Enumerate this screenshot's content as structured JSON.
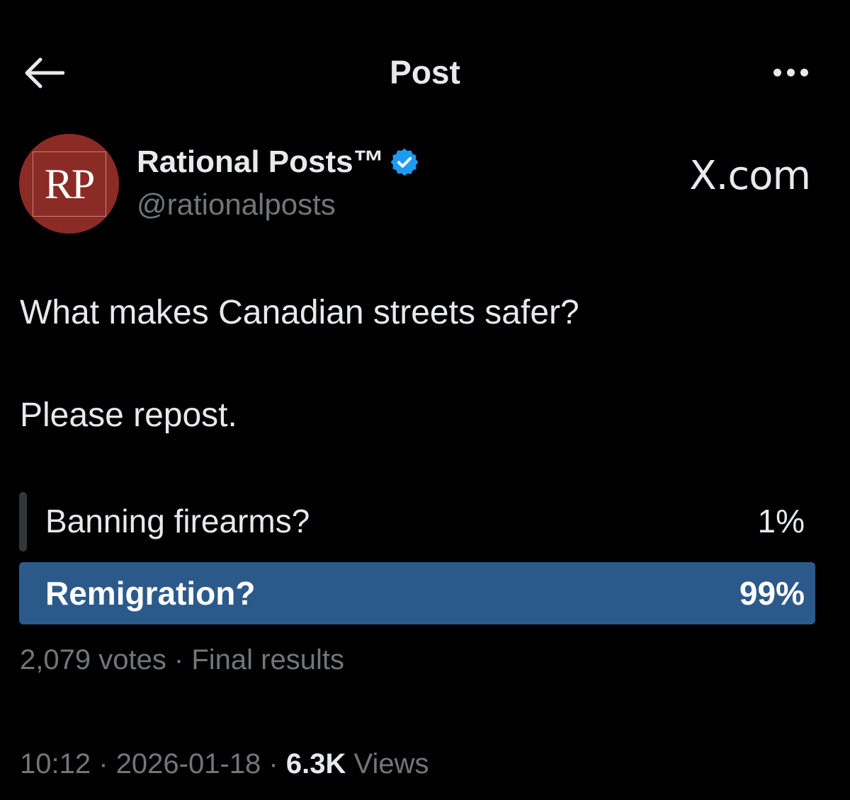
{
  "header": {
    "title": "Post",
    "back_icon": "arrow-left-icon",
    "more_icon": "more-horizontal-icon"
  },
  "author": {
    "avatar_text": "RP",
    "avatar_color": "#8b2b25",
    "display_name": "Rational Posts™",
    "verified_color": "#1d9bf0",
    "handle": "@rationalposts"
  },
  "brand_label": "X.com",
  "post": {
    "line1": "What makes Canadian streets safer?",
    "line2": "Please repost."
  },
  "poll": {
    "options": [
      {
        "label": "Banning firearms?",
        "percent": "1%",
        "value": 1,
        "winner": false
      },
      {
        "label": "Remigration?",
        "percent": "99%",
        "value": 99,
        "winner": true
      }
    ],
    "winner_color": "#2b5a8a",
    "votes": "2,079 votes",
    "separator": "·",
    "status": "Final results",
    "summary": "2,079 votes · Final results"
  },
  "meta": {
    "time": "10:12",
    "date": "2026-01-18",
    "separator": "·",
    "views_count": "6.3K",
    "views_label": "Views"
  }
}
